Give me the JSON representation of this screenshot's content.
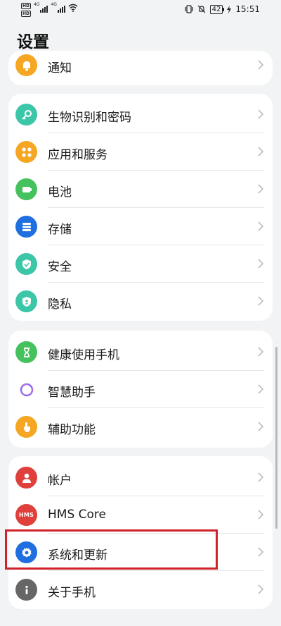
{
  "status_bar": {
    "sim1": "HD",
    "sim2": "HD",
    "net1": "4G",
    "net2": "4G",
    "battery": "42",
    "time": "15:51"
  },
  "page_title": "设置",
  "groups": [
    {
      "items": [
        {
          "label": "通知",
          "icon": "bell-icon",
          "color": "#f5a623"
        }
      ]
    },
    {
      "items": [
        {
          "label": "生物识别和密码",
          "icon": "key-icon",
          "color": "#3cc6a8"
        },
        {
          "label": "应用和服务",
          "icon": "apps-grid-icon",
          "color": "#f5a623"
        },
        {
          "label": "电池",
          "icon": "battery-icon",
          "color": "#45c25e"
        },
        {
          "label": "存储",
          "icon": "storage-icon",
          "color": "#1f6fe0"
        },
        {
          "label": "安全",
          "icon": "shield-icon",
          "color": "#3cc6a8"
        },
        {
          "label": "隐私",
          "icon": "privacy-icon",
          "color": "#3cc6a8"
        }
      ]
    },
    {
      "items": [
        {
          "label": "健康使用手机",
          "icon": "hourglass-icon",
          "color": "#45c25e"
        },
        {
          "label": "智慧助手",
          "icon": "assistant-ring-icon",
          "color": "#8a6bf0"
        },
        {
          "label": "辅助功能",
          "icon": "hand-tap-icon",
          "color": "#f5a623"
        }
      ]
    },
    {
      "items": [
        {
          "label": "帐户",
          "icon": "user-icon",
          "color": "#e0403b"
        },
        {
          "label": "HMS Core",
          "icon": "hms-icon",
          "color": "#e0403b"
        },
        {
          "label": "系统和更新",
          "icon": "gear-icon",
          "color": "#1f6fe0"
        },
        {
          "label": "关于手机",
          "icon": "info-icon",
          "color": "#666666"
        }
      ]
    }
  ],
  "hms_text": "HMS",
  "highlight_color": "#d0222b"
}
